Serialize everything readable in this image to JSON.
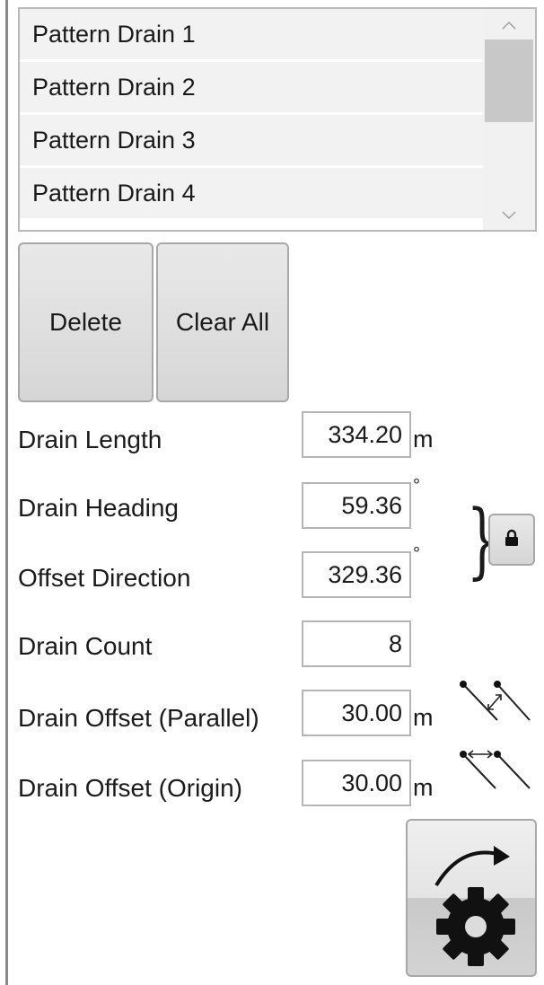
{
  "drains_list": {
    "items": [
      "Pattern Drain 1",
      "Pattern Drain 2",
      "Pattern Drain 3",
      "Pattern Drain 4"
    ],
    "scroll_up": "^",
    "scroll_down": "v"
  },
  "buttons": {
    "delete_label": "Delete",
    "clear_all_label": "Clear All"
  },
  "fields": {
    "drain_length": {
      "label": "Drain Length",
      "value": "334.20",
      "unit": "m"
    },
    "drain_heading": {
      "label": "Drain Heading",
      "value": "59.36",
      "unit": "°"
    },
    "offset_direction": {
      "label": "Offset Direction",
      "value": "329.36",
      "unit": "°"
    },
    "drain_count": {
      "label": "Drain Count",
      "value": "8"
    },
    "drain_offset_parallel": {
      "label": "Drain Offset (Parallel)",
      "value": "30.00",
      "unit": "m"
    },
    "drain_offset_origin": {
      "label": "Drain Offset (Origin)",
      "value": "30.00",
      "unit": "m"
    }
  },
  "icons": {
    "lock": "lock-icon",
    "parallel_offset": "parallel-offset-icon",
    "origin_offset": "origin-offset-icon",
    "generate": "rotate-gear-icon"
  }
}
